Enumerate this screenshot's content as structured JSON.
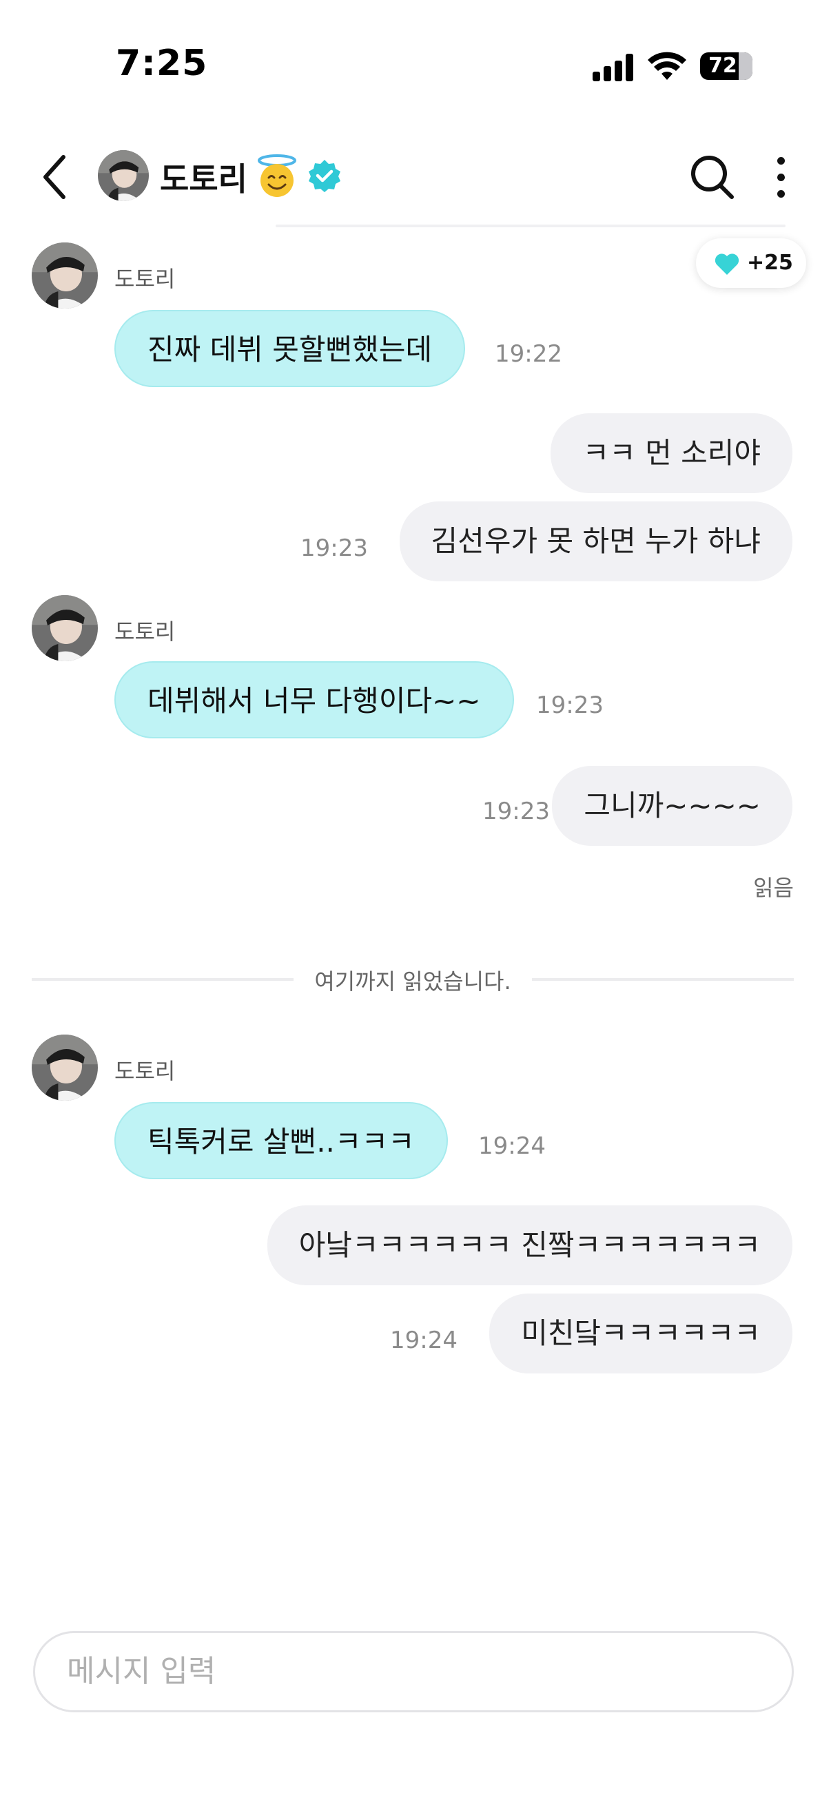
{
  "status_bar": {
    "time": "7:25",
    "battery": "72"
  },
  "header": {
    "contact_name": "도토리",
    "halo_emoji": "😇"
  },
  "reaction_badge": {
    "count": "+25"
  },
  "messages": [
    {
      "dir": "in",
      "sender": "도토리",
      "text": "진짜 데뷔 못할뻔했는데",
      "time": "19:22"
    },
    {
      "dir": "out",
      "text": "ㅋㅋ 먼 소리야"
    },
    {
      "dir": "out",
      "text": "김선우가 못 하면 누가 하냐",
      "time": "19:23"
    },
    {
      "dir": "in",
      "sender": "도토리",
      "text": "데뷔해서 너무 다행이다~~",
      "time": "19:23"
    },
    {
      "dir": "out",
      "text": "그니까~~~~",
      "time": "19:23"
    },
    {
      "dir": "in",
      "sender": "도토리",
      "text": "틱톡커로 살뻔..ㅋㅋㅋ",
      "time": "19:24"
    },
    {
      "dir": "out",
      "text": "아낰ㅋㅋㅋㅋㅋㅋ 진짴ㅋㅋㅋㅋㅋㅋㅋ"
    },
    {
      "dir": "out",
      "text": "미친닼ㅋㅋㅋㅋㅋㅋ",
      "time": "19:24"
    }
  ],
  "read_receipt": "읽음",
  "read_divider": "여기까지 읽었습니다.",
  "composer": {
    "placeholder": "메시지 입력"
  },
  "colors": {
    "incoming_bubble": "#bff3f5",
    "outgoing_bubble": "#f1f1f4",
    "verified_badge": "#2fc9d6"
  }
}
